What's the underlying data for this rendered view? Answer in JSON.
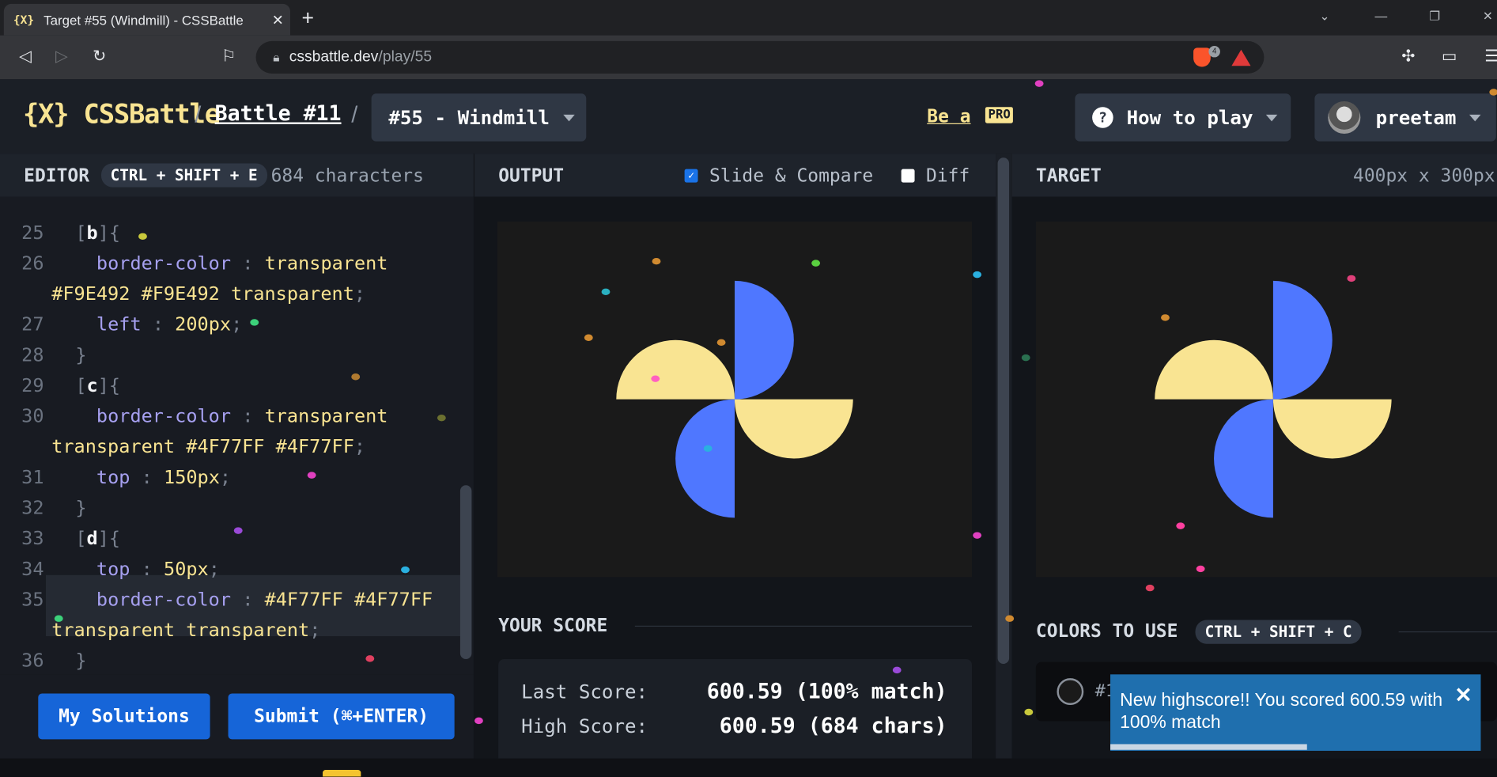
{
  "browser": {
    "tab_title": "Target #55 (Windmill) - CSSBattle",
    "tab_favicon": "{X}",
    "url_host": "cssbattle.dev",
    "url_path": "/play/55",
    "brave_count": "4"
  },
  "header": {
    "logo": "{X} CSSBattle",
    "battle": "Battle #11",
    "target_select": "#55 - Windmill",
    "be_a": "Be a",
    "pro": "PRO",
    "how_to_play": "How to play",
    "username": "preetam"
  },
  "editor": {
    "title": "EDITOR",
    "shortcut": "CTRL + SHIFT + E",
    "char_count": "684 characters",
    "my_solutions": "My Solutions",
    "submit": "Submit (⌘+ENTER)"
  },
  "output": {
    "title": "OUTPUT",
    "slide_compare": "Slide & Compare",
    "slide_checked": true,
    "diff": "Diff",
    "diff_checked": false
  },
  "target": {
    "title": "TARGET",
    "size": "400px x 300px"
  },
  "score": {
    "title": "YOUR SCORE",
    "last_label": "Last Score:",
    "last_value": "600.59 (100% match)",
    "high_label": "High Score:",
    "high_value": "600.59 (684 chars)"
  },
  "colors": {
    "title": "COLORS TO USE",
    "shortcut": "CTRL + SHIFT + C",
    "first_swatch_text": "#1",
    "palette": [
      "#1A1A1A",
      "#F9E492",
      "#4F77FF"
    ]
  },
  "toast": {
    "message": "New highscore!! You scored 600.59 with 100% match",
    "progress": 0.53
  }
}
